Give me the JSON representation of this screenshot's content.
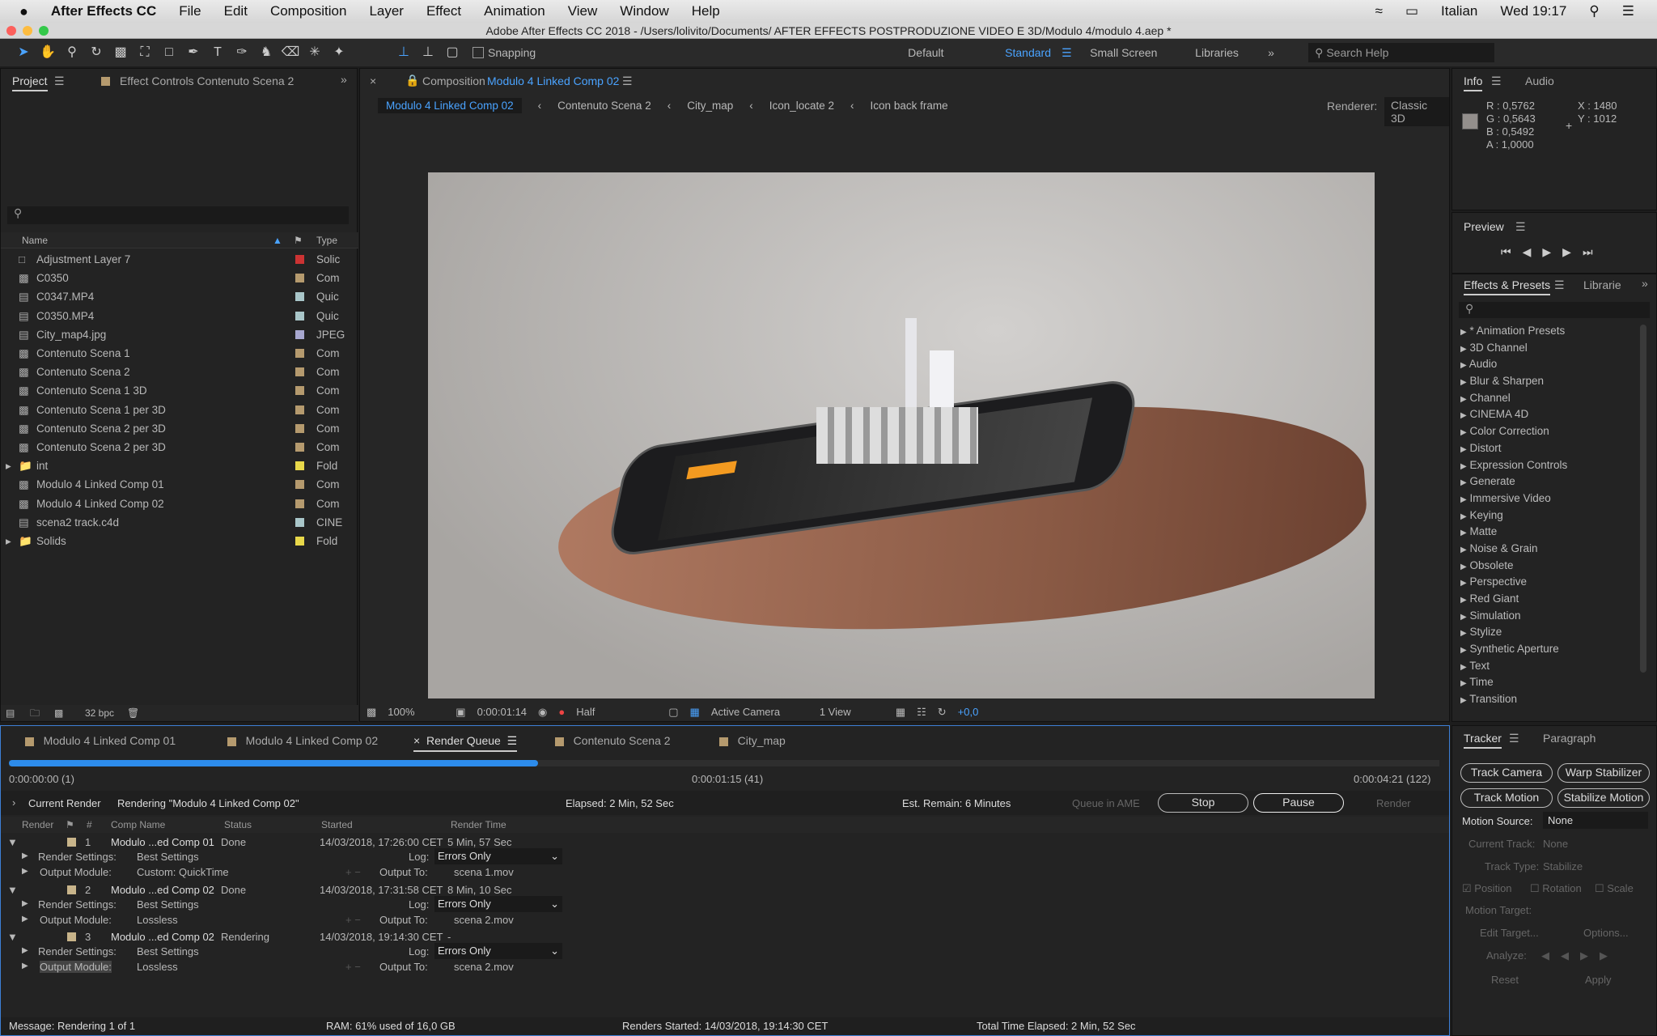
{
  "menubar": {
    "app": "After Effects CC",
    "items": [
      "File",
      "Edit",
      "Composition",
      "Layer",
      "Effect",
      "Animation",
      "View",
      "Window",
      "Help"
    ],
    "language": "Italian",
    "clock": "Wed 19:17"
  },
  "window_title": "Adobe After Effects CC 2018 - /Users/lolivito/Documents/ AFTER EFFECTS POSTPRODUZIONE VIDEO E 3D/Modulo 4/modulo 4.aep *",
  "toolbar": {
    "snapping": "Snapping",
    "workspaces": [
      "Default",
      "Standard",
      "Small Screen",
      "Libraries"
    ],
    "active_workspace": "Standard",
    "search_placeholder": "Search Help"
  },
  "project": {
    "tab": "Project",
    "effect_controls_tab": "Effect Controls Contenuto Scena 2",
    "columns": {
      "name": "Name",
      "type": "Type"
    },
    "bpc": "32 bpc",
    "items": [
      {
        "name": "Adjustment Layer 7",
        "type": "Solic",
        "color": "#c33",
        "kind": "solid"
      },
      {
        "name": "C0350",
        "type": "Com",
        "color": "#b59a6e",
        "kind": "comp"
      },
      {
        "name": "C0347.MP4",
        "type": "Quic",
        "color": "#a9c6c9",
        "kind": "file"
      },
      {
        "name": "C0350.MP4",
        "type": "Quic",
        "color": "#a9c6c9",
        "kind": "file"
      },
      {
        "name": "City_map4.jpg",
        "type": "JPEG",
        "color": "#a8a8d0",
        "kind": "file"
      },
      {
        "name": "Contenuto Scena 1",
        "type": "Com",
        "color": "#b59a6e",
        "kind": "comp"
      },
      {
        "name": "Contenuto Scena 2",
        "type": "Com",
        "color": "#b59a6e",
        "kind": "comp"
      },
      {
        "name": "Contenuto Scena 1 3D",
        "type": "Com",
        "color": "#b59a6e",
        "kind": "comp"
      },
      {
        "name": "Contenuto Scena 1 per 3D",
        "type": "Com",
        "color": "#b59a6e",
        "kind": "comp"
      },
      {
        "name": "Contenuto Scena 2 per 3D",
        "type": "Com",
        "color": "#b59a6e",
        "kind": "comp"
      },
      {
        "name": "Contenuto Scena 2 per 3D",
        "type": "Com",
        "color": "#b59a6e",
        "kind": "comp"
      },
      {
        "name": "int",
        "type": "Fold",
        "color": "#e8d84a",
        "kind": "folder"
      },
      {
        "name": "Modulo 4 Linked Comp 01",
        "type": "Com",
        "color": "#b59a6e",
        "kind": "comp"
      },
      {
        "name": "Modulo 4 Linked Comp 02",
        "type": "Com",
        "color": "#b59a6e",
        "kind": "comp"
      },
      {
        "name": "scena2 track.c4d",
        "type": "CINE",
        "color": "#a9c6c9",
        "kind": "file"
      },
      {
        "name": "Solids",
        "type": "Fold",
        "color": "#e8d84a",
        "kind": "folder"
      }
    ]
  },
  "composition": {
    "label": "Composition",
    "name": "Modulo 4 Linked Comp 02",
    "breadcrumbs": [
      "Modulo 4 Linked Comp 02",
      "Contenuto Scena 2",
      "City_map",
      "Icon_locate 2",
      "Icon back frame"
    ],
    "renderer_label": "Renderer:",
    "renderer": "Classic 3D",
    "footer": {
      "zoom": "100%",
      "time": "0:00:01:14",
      "resolution": "Half",
      "camera": "Active Camera",
      "views": "1 View",
      "exposure": "+0,0"
    }
  },
  "info": {
    "tab": "Info",
    "audio_tab": "Audio",
    "r": "R : 0,5762",
    "g": "G : 0,5643",
    "b": "B : 0,5492",
    "a": "A : 1,0000",
    "x": "X : 1480",
    "y": "Y : 1012",
    "swatch": "#938f8c"
  },
  "preview": {
    "title": "Preview"
  },
  "effects": {
    "tab": "Effects & Presets",
    "libraries_tab": "Librarie",
    "items": [
      "* Animation Presets",
      "3D Channel",
      "Audio",
      "Blur & Sharpen",
      "Channel",
      "CINEMA 4D",
      "Color Correction",
      "Distort",
      "Expression Controls",
      "Generate",
      "Immersive Video",
      "Keying",
      "Matte",
      "Noise & Grain",
      "Obsolete",
      "Perspective",
      "Red Giant",
      "Simulation",
      "Stylize",
      "Synthetic Aperture",
      "Text",
      "Time",
      "Transition"
    ]
  },
  "bottom_tabs": [
    "Modulo 4 Linked Comp 01",
    "Modulo 4 Linked Comp 02",
    "Render Queue",
    "Contenuto Scena 2",
    "City_map"
  ],
  "render_queue": {
    "progress": 0.37,
    "start_time": "0:00:00:00 (1)",
    "current_time": "0:00:01:15 (41)",
    "end_time": "0:00:04:21 (122)",
    "current_render_label": "Current Render",
    "rendering_text": "Rendering \"Modulo 4 Linked Comp 02\"",
    "elapsed": "Elapsed: 2 Min, 52 Sec",
    "remain": "Est. Remain: 6 Minutes",
    "queue_ame": "Queue in AME",
    "stop": "Stop",
    "pause": "Pause",
    "render": "Render",
    "columns": [
      "Render",
      "#",
      "Comp Name",
      "Status",
      "Started",
      "Render Time"
    ],
    "labels": {
      "render_settings": "Render Settings:",
      "output_module": "Output Module:",
      "log": "Log:",
      "output_to": "Output To:"
    },
    "items": [
      {
        "num": "1",
        "comp": "Modulo ...ed Comp 01",
        "status": "Done",
        "started": "14/03/2018, 17:26:00 CET",
        "time": "5 Min, 57 Sec",
        "settings": "Best Settings",
        "module": "Custom: QuickTime",
        "log": "Errors Only",
        "output": "scena 1.mov"
      },
      {
        "num": "2",
        "comp": "Modulo ...ed Comp 02",
        "status": "Done",
        "started": "14/03/2018, 17:31:58 CET",
        "time": "8 Min, 10 Sec",
        "settings": "Best Settings",
        "module": "Lossless",
        "log": "Errors Only",
        "output": "scena 2.mov"
      },
      {
        "num": "3",
        "comp": "Modulo ...ed Comp 02",
        "status": "Rendering",
        "started": "14/03/2018, 19:14:30 CET",
        "time": "-",
        "settings": "Best Settings",
        "module": "Lossless",
        "log": "Errors Only",
        "output": "scena 2.mov"
      }
    ],
    "status": {
      "message": "Message: Rendering 1 of 1",
      "ram": "RAM: 61% used of 16,0 GB",
      "started": "Renders Started: 14/03/2018, 19:14:30 CET",
      "total": "Total Time Elapsed: 2 Min, 52 Sec"
    }
  },
  "tracker": {
    "tab": "Tracker",
    "paragraph_tab": "Paragraph",
    "track_camera": "Track Camera",
    "warp": "Warp Stabilizer",
    "track_motion": "Track Motion",
    "stabilize": "Stabilize Motion",
    "motion_source_label": "Motion Source:",
    "motion_source": "None",
    "current_track_label": "Current Track:",
    "current_track": "None",
    "track_type_label": "Track Type:",
    "track_type": "Stabilize",
    "position": "Position",
    "rotation": "Rotation",
    "scale": "Scale",
    "motion_target": "Motion Target:",
    "edit_target": "Edit Target...",
    "options": "Options...",
    "analyze": "Analyze:",
    "reset": "Reset",
    "apply": "Apply"
  }
}
